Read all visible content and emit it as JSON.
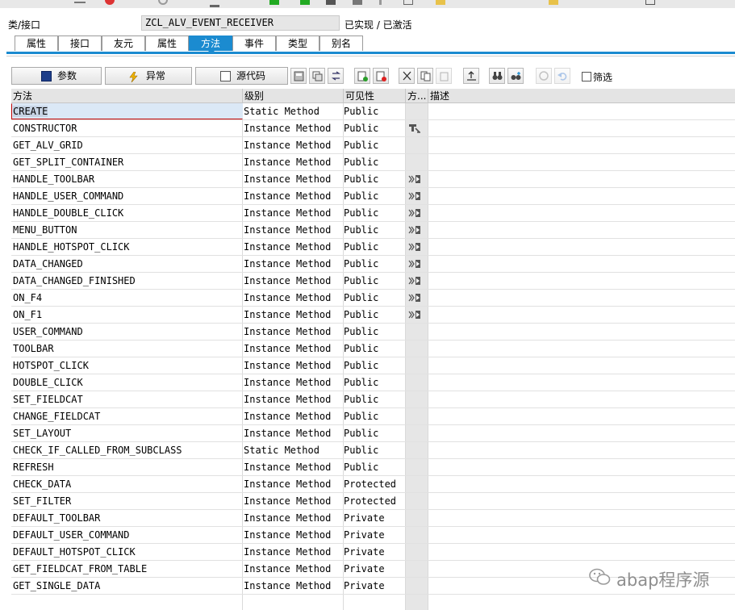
{
  "header": {
    "class_label": "类/接口",
    "class_name": "ZCL_ALV_EVENT_RECEIVER",
    "status": "已实现 / 已激活"
  },
  "tabs": [
    "属性",
    "接口",
    "友元",
    "属性",
    "方法",
    "事件",
    "类型",
    "别名"
  ],
  "active_tab": "方法",
  "toolbar": {
    "params_label": "参数",
    "exceptions_label": "异常",
    "source_label": "源代码",
    "filter_label": "筛选"
  },
  "grid": {
    "columns": [
      "方法",
      "级别",
      "可见性",
      "方...",
      "描述"
    ],
    "rows": [
      {
        "method": "CREATE",
        "level": "Static Method",
        "visibility": "Public",
        "icon": ""
      },
      {
        "method": "CONSTRUCTOR",
        "level": "Instance Method",
        "visibility": "Public",
        "icon": "constructor-icon"
      },
      {
        "method": "GET_ALV_GRID",
        "level": "Instance Method",
        "visibility": "Public",
        "icon": ""
      },
      {
        "method": "GET_SPLIT_CONTAINER",
        "level": "Instance Method",
        "visibility": "Public",
        "icon": ""
      },
      {
        "method": "HANDLE_TOOLBAR",
        "level": "Instance Method",
        "visibility": "Public",
        "icon": "event-handler-icon"
      },
      {
        "method": "HANDLE_USER_COMMAND",
        "level": "Instance Method",
        "visibility": "Public",
        "icon": "event-handler-icon"
      },
      {
        "method": "HANDLE_DOUBLE_CLICK",
        "level": "Instance Method",
        "visibility": "Public",
        "icon": "event-handler-icon"
      },
      {
        "method": "MENU_BUTTON",
        "level": "Instance Method",
        "visibility": "Public",
        "icon": "event-handler-icon"
      },
      {
        "method": "HANDLE_HOTSPOT_CLICK",
        "level": "Instance Method",
        "visibility": "Public",
        "icon": "event-handler-icon"
      },
      {
        "method": "DATA_CHANGED",
        "level": "Instance Method",
        "visibility": "Public",
        "icon": "event-handler-icon"
      },
      {
        "method": "DATA_CHANGED_FINISHED",
        "level": "Instance Method",
        "visibility": "Public",
        "icon": "event-handler-icon"
      },
      {
        "method": "ON_F4",
        "level": "Instance Method",
        "visibility": "Public",
        "icon": "event-handler-icon"
      },
      {
        "method": "ON_F1",
        "level": "Instance Method",
        "visibility": "Public",
        "icon": "event-handler-icon"
      },
      {
        "method": "USER_COMMAND",
        "level": "Instance Method",
        "visibility": "Public",
        "icon": ""
      },
      {
        "method": "TOOLBAR",
        "level": "Instance Method",
        "visibility": "Public",
        "icon": ""
      },
      {
        "method": "HOTSPOT_CLICK",
        "level": "Instance Method",
        "visibility": "Public",
        "icon": ""
      },
      {
        "method": "DOUBLE_CLICK",
        "level": "Instance Method",
        "visibility": "Public",
        "icon": ""
      },
      {
        "method": "SET_FIELDCAT",
        "level": "Instance Method",
        "visibility": "Public",
        "icon": ""
      },
      {
        "method": "CHANGE_FIELDCAT",
        "level": "Instance Method",
        "visibility": "Public",
        "icon": ""
      },
      {
        "method": "SET_LAYOUT",
        "level": "Instance Method",
        "visibility": "Public",
        "icon": ""
      },
      {
        "method": "CHECK_IF_CALLED_FROM_SUBCLASS",
        "level": "Static Method",
        "visibility": "Public",
        "icon": ""
      },
      {
        "method": "REFRESH",
        "level": "Instance Method",
        "visibility": "Public",
        "icon": ""
      },
      {
        "method": "CHECK_DATA",
        "level": "Instance Method",
        "visibility": "Protected",
        "icon": ""
      },
      {
        "method": "SET_FILTER",
        "level": "Instance Method",
        "visibility": "Protected",
        "icon": ""
      },
      {
        "method": "DEFAULT_TOOLBAR",
        "level": "Instance Method",
        "visibility": "Private",
        "icon": ""
      },
      {
        "method": "DEFAULT_USER_COMMAND",
        "level": "Instance Method",
        "visibility": "Private",
        "icon": ""
      },
      {
        "method": "DEFAULT_HOTSPOT_CLICK",
        "level": "Instance Method",
        "visibility": "Private",
        "icon": ""
      },
      {
        "method": "GET_FIELDCAT_FROM_TABLE",
        "level": "Instance Method",
        "visibility": "Private",
        "icon": ""
      },
      {
        "method": "GET_SINGLE_DATA",
        "level": "Instance Method",
        "visibility": "Private",
        "icon": ""
      }
    ]
  },
  "watermark": "abap程序源",
  "colors": {
    "accent": "#1b8bd0",
    "selection": "#dbe8f6",
    "header_bg": "#e4e4e4"
  }
}
